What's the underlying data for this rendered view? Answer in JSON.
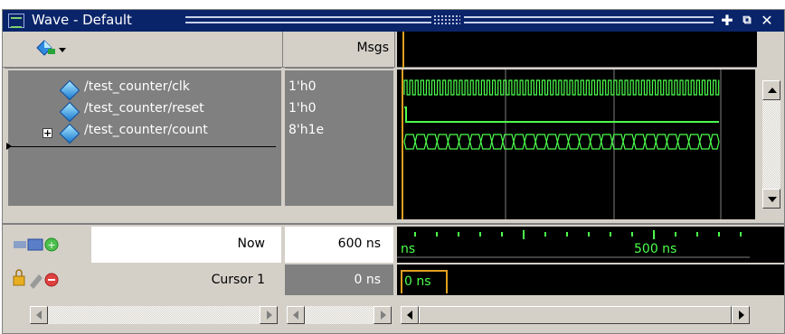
{
  "window": {
    "title": "Wave - Default"
  },
  "header": {
    "msgs_label": "Msgs"
  },
  "signals": [
    {
      "name": "/test_counter/clk",
      "value": "1'h0",
      "expandable": false
    },
    {
      "name": "/test_counter/reset",
      "value": "1'h0",
      "expandable": false
    },
    {
      "name": "/test_counter/count",
      "value": "8'h1e",
      "expandable": true
    }
  ],
  "status": {
    "now_label": "Now",
    "now_value": "600 ns",
    "cursor_label": "Cursor 1",
    "cursor_value": "0 ns"
  },
  "timeline": {
    "left_tick_label": "ns",
    "mid_tick_label": "500 ns",
    "cursor_box_label": "0 ns"
  },
  "colors": {
    "wave_green": "#4cff4c",
    "cursor_orange": "#e0a020",
    "title_bar": "#0a246a"
  }
}
